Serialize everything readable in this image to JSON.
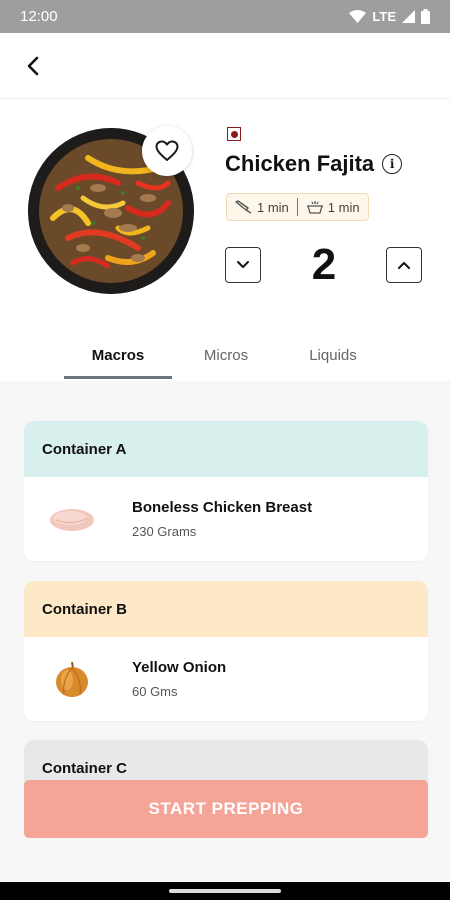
{
  "status_bar": {
    "time": "12:00",
    "network": "LTE"
  },
  "recipe": {
    "title": "Chicken Fajita",
    "prep_time": "1 min",
    "cook_time": "1 min",
    "servings": "2"
  },
  "tabs": [
    {
      "label": "Macros",
      "active": true
    },
    {
      "label": "Micros",
      "active": false
    },
    {
      "label": "Liquids",
      "active": false
    }
  ],
  "containers": [
    {
      "label": "Container A",
      "color": "#d7efed",
      "ingredient": {
        "name": "Boneless Chicken Breast",
        "qty": "230 Grams",
        "icon": "chicken-breast-icon"
      }
    },
    {
      "label": "Container B",
      "color": "#fde8c7",
      "ingredient": {
        "name": "Yellow Onion",
        "qty": "60 Gms",
        "icon": "onion-icon"
      }
    },
    {
      "label": "Container C",
      "color": "#e8e8e8"
    }
  ],
  "cta": {
    "label": "START PREPPING",
    "color": "#f4a598"
  }
}
